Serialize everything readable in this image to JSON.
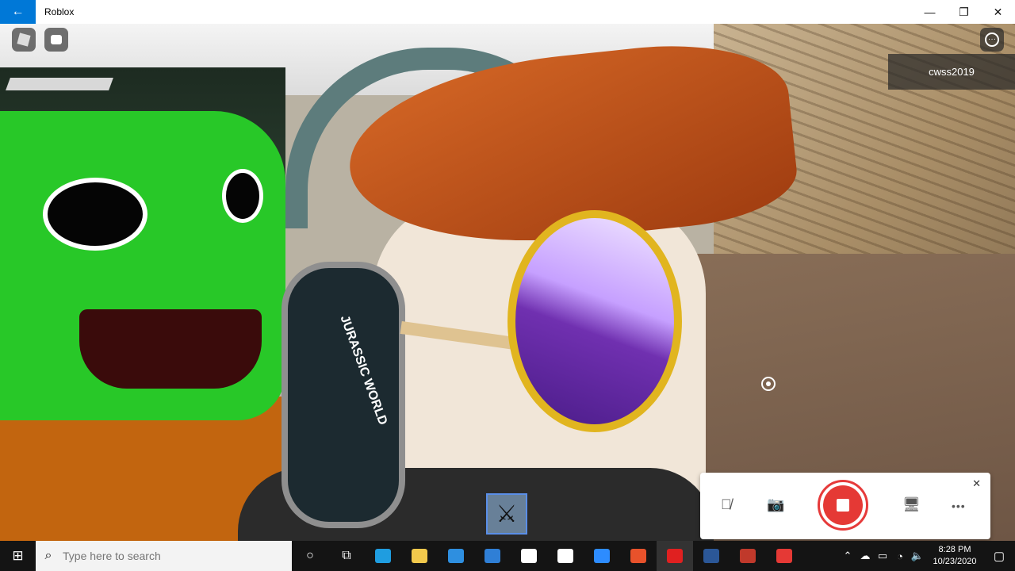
{
  "window": {
    "title": "Roblox",
    "back_icon": "←",
    "minimize_icon": "—",
    "maximize_icon": "❐",
    "close_icon": "✕"
  },
  "game": {
    "player_list": [
      "cwss2019"
    ],
    "headphone_text": "JURASSIC WORLD",
    "hotbar_tool_icon": "⚔"
  },
  "capture_bar": {
    "mic_icon": "🎙̸",
    "camera_icon": "📷",
    "display_icon": "🖥",
    "more_icon": "•••",
    "close_icon": "✕"
  },
  "taskbar": {
    "start_icon": "⊞",
    "search_icon": "⌕",
    "search_placeholder": "Type here to search",
    "cortana_icon": "○",
    "taskview_icon": "⧉",
    "apps": [
      {
        "name": "edge",
        "color": "#1f9de0"
      },
      {
        "name": "file-explorer",
        "color": "#f2c94c"
      },
      {
        "name": "store",
        "color": "#2e8fe0"
      },
      {
        "name": "mail",
        "color": "#2f7fd6"
      },
      {
        "name": "dropbox",
        "color": "#ffffff"
      },
      {
        "name": "stream",
        "color": "#ffffff"
      },
      {
        "name": "zoom",
        "color": "#2d8cff"
      },
      {
        "name": "office",
        "color": "#e8522b"
      },
      {
        "name": "roblox",
        "color": "#e02020"
      },
      {
        "name": "word",
        "color": "#2b5797"
      },
      {
        "name": "game-app",
        "color": "#c0392b"
      },
      {
        "name": "recorder",
        "color": "#e53935"
      }
    ],
    "time": "8:28 PM",
    "date": "10/23/2020"
  }
}
